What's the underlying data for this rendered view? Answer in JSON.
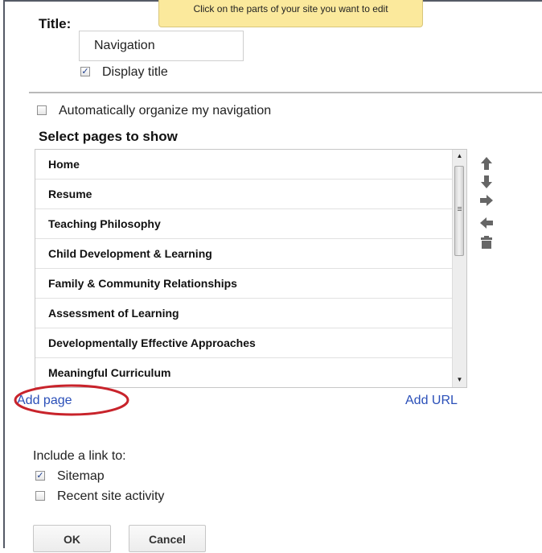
{
  "tooltip": {
    "text": "Click on the parts of your site you want to edit",
    "color": "#fbe99c"
  },
  "title_section": {
    "label": "Title:",
    "input_value": "Navigation",
    "display_title": {
      "label": "Display title",
      "checked": true
    }
  },
  "auto_organize": {
    "label": "Automatically organize my navigation",
    "checked": false
  },
  "pages_section": {
    "heading": "Select pages to show",
    "pages": [
      "Home",
      "Resume",
      "Teaching Philosophy",
      "Child Development & Learning",
      "Family & Community Relationships",
      "Assessment of Learning",
      "Developmentally Effective Approaches",
      "Meaningful Curriculum"
    ],
    "tools": [
      "arrow-up-icon",
      "arrow-down-icon",
      "arrow-right-icon",
      "arrow-left-icon",
      "trash-icon"
    ]
  },
  "links": {
    "add_page": "Add page",
    "add_url": "Add URL"
  },
  "include_section": {
    "label": "Include a link to:",
    "options": [
      {
        "label": "Sitemap",
        "checked": true
      },
      {
        "label": "Recent site activity",
        "checked": false
      }
    ]
  },
  "buttons": {
    "ok": "OK",
    "cancel": "Cancel"
  },
  "colors": {
    "link": "#2a4fb8",
    "annotation": "#c8232b"
  }
}
